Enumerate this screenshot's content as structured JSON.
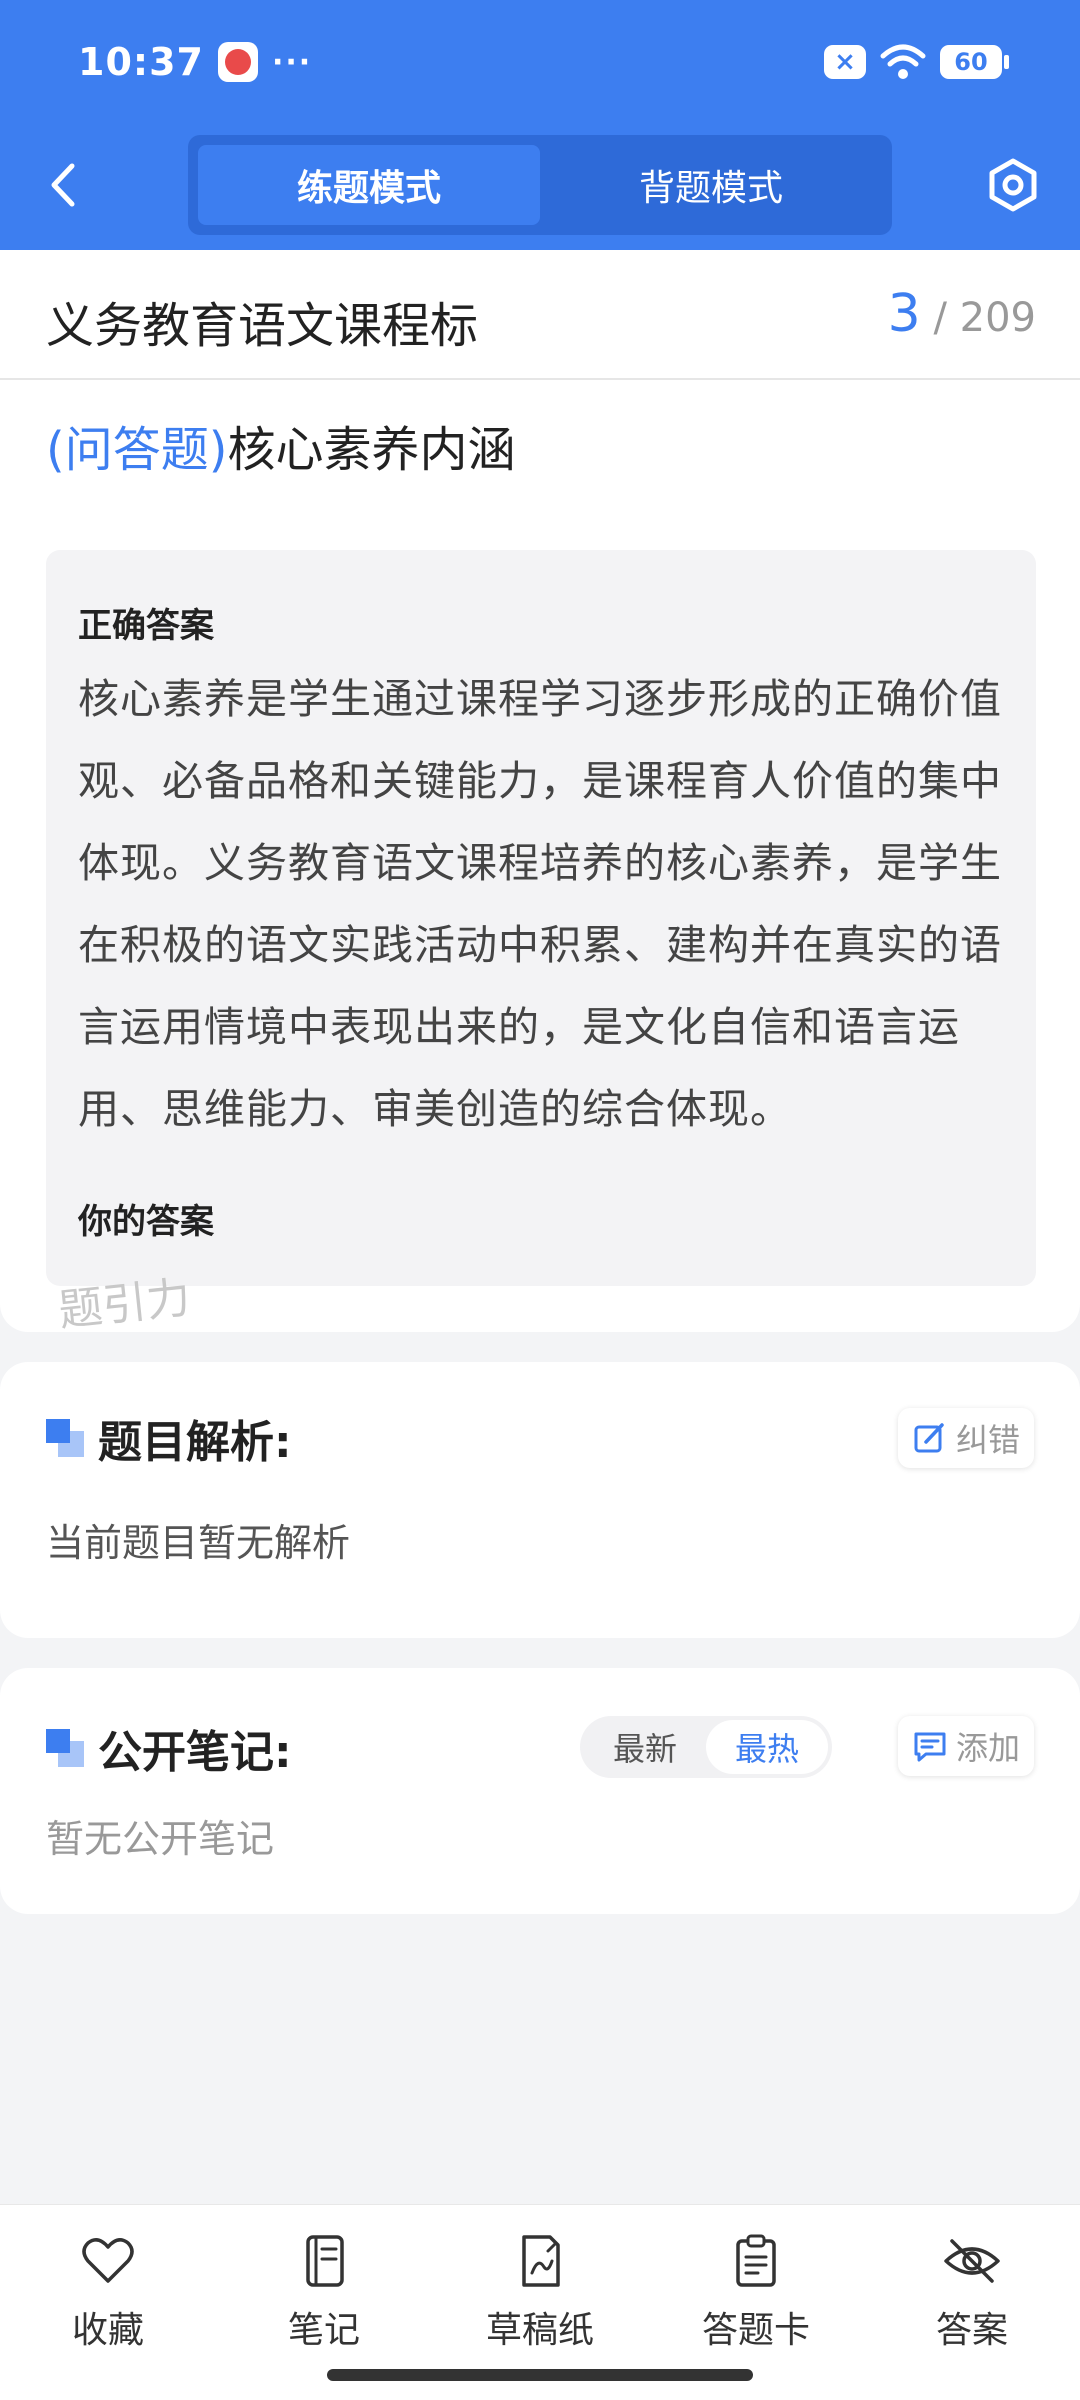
{
  "status_bar": {
    "time": "10:37",
    "more": "···",
    "battery": "60",
    "sim_status": "×"
  },
  "nav": {
    "tabs": [
      {
        "label": "练题模式",
        "active": true
      },
      {
        "label": "背题模式",
        "active": false
      }
    ]
  },
  "title_bar": {
    "title": "义务教育语文课程标",
    "current": "3",
    "total": "/ 209"
  },
  "question": {
    "type": "(问答题)",
    "text": "核心素养内涵",
    "correct_answer_label": "正确答案",
    "correct_answer": "核心素养是学生通过课程学习逐步形成的正确价值观、必备品格和关键能力，是课程育人价值的集中体现。义务教育语文课程培养的核心素养，是学生在积极的语文实践活动中积累、建构并在真实的语言运用情境中表现出来的，是文化自信和语言运用、思维能力、审美创造的综合体现。",
    "your_answer_label": "你的答案",
    "watermark": "题引力"
  },
  "analysis": {
    "title": "题目解析:",
    "correct_btn": "纠错",
    "empty": "当前题目暂无解析"
  },
  "notes": {
    "title": "公开笔记:",
    "sort_latest": "最新",
    "sort_hot": "最热",
    "add_btn": "添加",
    "empty": "暂无公开笔记"
  },
  "bottom_bar": {
    "favorite": "收藏",
    "notes": "笔记",
    "scratch": "草稿纸",
    "answer_card": "答题卡",
    "answer": "答案"
  },
  "colors": {
    "primary": "#3d7ef0",
    "background": "#f3f4f6"
  }
}
